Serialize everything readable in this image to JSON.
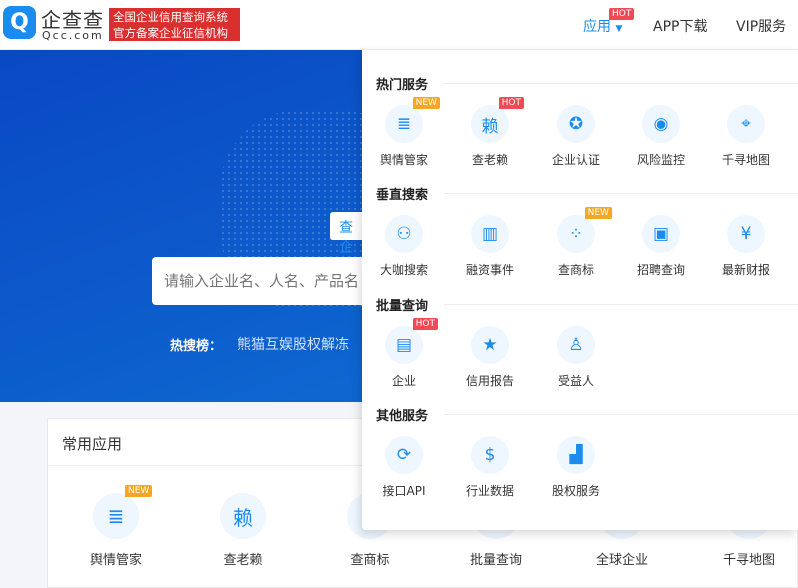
{
  "header": {
    "logo_glyph": "Q",
    "logo_cn": "企查查",
    "logo_en": "Qcc.com",
    "slogan_line1": "全国企业信用查询系统",
    "slogan_line2": "官方备案企业征信机构",
    "nav": [
      {
        "label": "应用",
        "badge": "HOT"
      },
      {
        "label": "APP下载"
      },
      {
        "label": "VIP服务"
      }
    ]
  },
  "hero": {
    "tab": "查企",
    "search_placeholder": "请输入企业名、人名、产品名",
    "hot_label": "热搜榜：",
    "hot_item": "熊猫互娱股权解冻"
  },
  "common_apps": {
    "title": "常用应用",
    "items": [
      {
        "label": "舆情管家",
        "icon": "news-icon",
        "glyph": "≣",
        "badge": "NEW"
      },
      {
        "label": "查老赖",
        "icon": "debtor-icon",
        "glyph": "赖"
      },
      {
        "label": "查商标",
        "icon": "trademark-icon",
        "glyph": "⁘"
      },
      {
        "label": "批量查询",
        "icon": "batch-icon",
        "glyph": "▦"
      },
      {
        "label": "全球企业",
        "icon": "globe-icon",
        "glyph": "◎"
      },
      {
        "label": "千寻地图",
        "icon": "map-icon",
        "glyph": "⌖"
      }
    ]
  },
  "dropdown": {
    "sections": [
      {
        "title": "热门服务",
        "items": [
          {
            "label": "舆情管家",
            "icon": "news-icon",
            "glyph": "≣",
            "badge": "NEW"
          },
          {
            "label": "查老赖",
            "icon": "debtor-icon",
            "glyph": "赖",
            "badge": "HOT"
          },
          {
            "label": "企业认证",
            "icon": "certificate-icon",
            "glyph": "✪"
          },
          {
            "label": "风险监控",
            "icon": "radar-icon",
            "glyph": "◉"
          },
          {
            "label": "千寻地图",
            "icon": "map-pin-icon",
            "glyph": "⌖"
          }
        ]
      },
      {
        "title": "垂直搜索",
        "items": [
          {
            "label": "大咖搜索",
            "icon": "people-icon",
            "glyph": "⚇"
          },
          {
            "label": "融资事件",
            "icon": "building-plus-icon",
            "glyph": "▥"
          },
          {
            "label": "查商标",
            "icon": "trademark-icon",
            "glyph": "⁘",
            "badge": "NEW"
          },
          {
            "label": "招聘查询",
            "icon": "briefcase-icon",
            "glyph": "▣"
          },
          {
            "label": "最新财报",
            "icon": "yen-report-icon",
            "glyph": "¥"
          }
        ]
      },
      {
        "title": "批量查询",
        "items": [
          {
            "label": "企业",
            "icon": "enterprise-icon",
            "glyph": "▤",
            "badge": "HOT"
          },
          {
            "label": "信用报告",
            "icon": "credit-report-icon",
            "glyph": "★"
          },
          {
            "label": "受益人",
            "icon": "beneficiary-icon",
            "glyph": "♙"
          }
        ]
      },
      {
        "title": "其他服务",
        "items": [
          {
            "label": "接口API",
            "icon": "api-icon",
            "glyph": "⟳"
          },
          {
            "label": "行业数据",
            "icon": "industry-data-icon",
            "glyph": "$"
          },
          {
            "label": "股权服务",
            "icon": "equity-icon",
            "glyph": "▟"
          }
        ]
      }
    ]
  }
}
